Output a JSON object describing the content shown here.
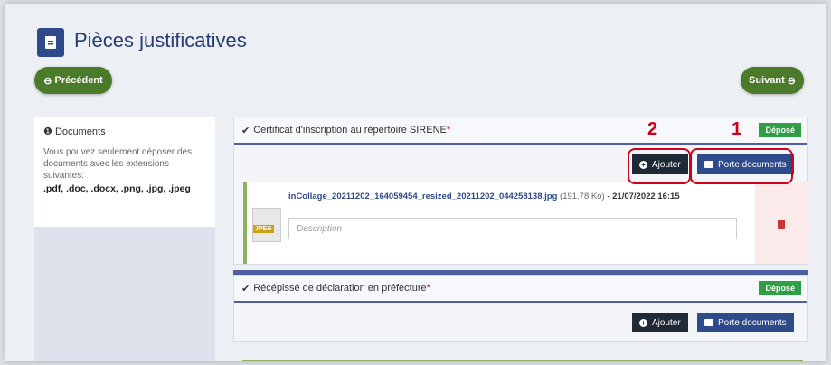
{
  "header": {
    "title": "Pièces justificatives",
    "icon": "document-icon"
  },
  "nav": {
    "previous_label": "Précédent",
    "next_label": "Suivant"
  },
  "sidebar": {
    "heading": "Documents",
    "note": "Vous pouvez seulement déposer des documents avec les extensions suivantes:",
    "extensions": ".pdf, .doc, .docx, .png, .jpg, .jpeg"
  },
  "cards": [
    {
      "title": "Certificat d'inscription au répertoire SIRENE",
      "required_mark": "*",
      "status": "Déposé",
      "ajouter_label": "Ajouter",
      "porte_label": "Porte documents",
      "file": {
        "name": "inCollage_20211202_164059454_resized_20211202_044258138.jpg",
        "size": "(191.78 Ko)",
        "date": "- 21/07/2022 16:15",
        "type_label": "JPEG",
        "description_placeholder": "Description"
      }
    },
    {
      "title": "Récépissé de déclaration en préfecture",
      "required_mark": "*",
      "status": "Déposé",
      "ajouter_label": "Ajouter",
      "porte_label": "Porte documents"
    }
  ],
  "annotations": {
    "marker_1": "1",
    "marker_2": "2"
  },
  "colors": {
    "brand": "#2e4a8b",
    "nav_green": "#4a7a2a",
    "status_green": "#2f9e44",
    "annotation_red": "#d0021b"
  }
}
